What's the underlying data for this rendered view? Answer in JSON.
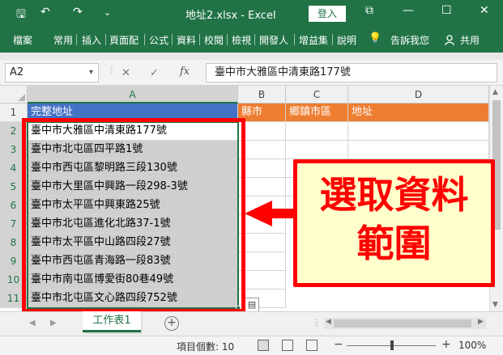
{
  "titlebar": {
    "title": "地址2.xlsx  -  Excel",
    "login_label": "登入",
    "save_glyph": "🖫",
    "undo_glyph": "↶",
    "redo_glyph": "↷",
    "customize_glyph": "⌄",
    "restore_glyph": "⧉",
    "minimize_glyph": "—",
    "maximize_glyph": "☐",
    "close_glyph": "✕"
  },
  "ribbon": {
    "tabs": [
      "檔案",
      "常用",
      "插入",
      "頁面配",
      "公式",
      "資料",
      "校閱",
      "檢視",
      "開發人",
      "增益集",
      "說明"
    ],
    "lightbulb_glyph": "💡",
    "tell_me": "告訴我您",
    "share": "共用"
  },
  "formula_bar": {
    "name_box": "A2",
    "dropdown_glyph": "▾",
    "dots_glyph": "⋮",
    "cancel_glyph": "✕",
    "enter_glyph": "✓",
    "fx": "fx",
    "value": "臺中市大雅區中清東路177號"
  },
  "grid": {
    "columns": [
      "A",
      "B",
      "C",
      "D"
    ],
    "rows": [
      "1",
      "2",
      "3",
      "4",
      "5",
      "6",
      "7",
      "8",
      "9",
      "10",
      "11"
    ],
    "header_row": [
      "完整地址",
      "縣市",
      "鄉鎮市區",
      "地址"
    ],
    "addresses": [
      "臺中市大雅區中清東路177號",
      "臺中市北屯區四平路1號",
      "臺中市西屯區黎明路三段130號",
      "臺中市大里區中興路一段298-3號",
      "臺中市太平區中興東路25號",
      "臺中市北屯區進化北路37-1號",
      "臺中市太平區中山路四段27號",
      "臺中市西屯區青海路一段83號",
      "臺中市南屯區博愛街80巷49號",
      "臺中市北屯區文心路四段752號"
    ],
    "quick_analysis_glyph": "▤",
    "scroll_up_glyph": "▲",
    "scroll_down_glyph": "▼"
  },
  "annotation": {
    "line1": "選取資料",
    "line2": "範圍",
    "color": "#ff0000",
    "bg": "#ffffcc"
  },
  "sheetbar": {
    "prev_glyph": "◀",
    "next_glyph": "▶",
    "tab": "工作表1",
    "add_glyph": "+",
    "dots_glyph": "⋮",
    "hscroll_left_glyph": "◀",
    "hscroll_right_glyph": "▶"
  },
  "statusbar": {
    "count_label": "項目個數: 10",
    "zoom_minus": "−",
    "zoom_plus": "+",
    "zoom": "100%"
  },
  "colors": {
    "excel_green": "#217346",
    "header_orange": "#ed7d31",
    "header_blue": "#4472c4"
  }
}
